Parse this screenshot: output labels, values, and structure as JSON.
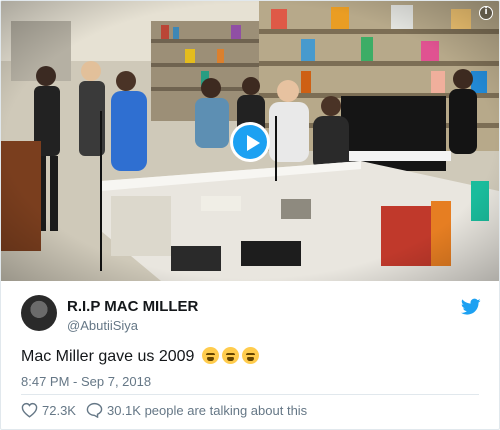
{
  "tweet": {
    "display_name": "R.I.P MAC MILLER",
    "handle": "@AbutiiSiya",
    "text": "Mac Miller gave us 2009",
    "emojis": [
      "loudly-crying-face",
      "loudly-crying-face",
      "loudly-crying-face"
    ],
    "timestamp": "8:47 PM - Sep 7, 2018",
    "likes": "72.3K",
    "conversation": "30.1K people are talking about this"
  },
  "media": {
    "type": "video",
    "info_glyph": "i",
    "accent": "#1da1f2"
  },
  "icons": [
    "info-icon",
    "play-icon",
    "twitter-bird-icon",
    "heart-icon",
    "speech-bubble-icon"
  ]
}
